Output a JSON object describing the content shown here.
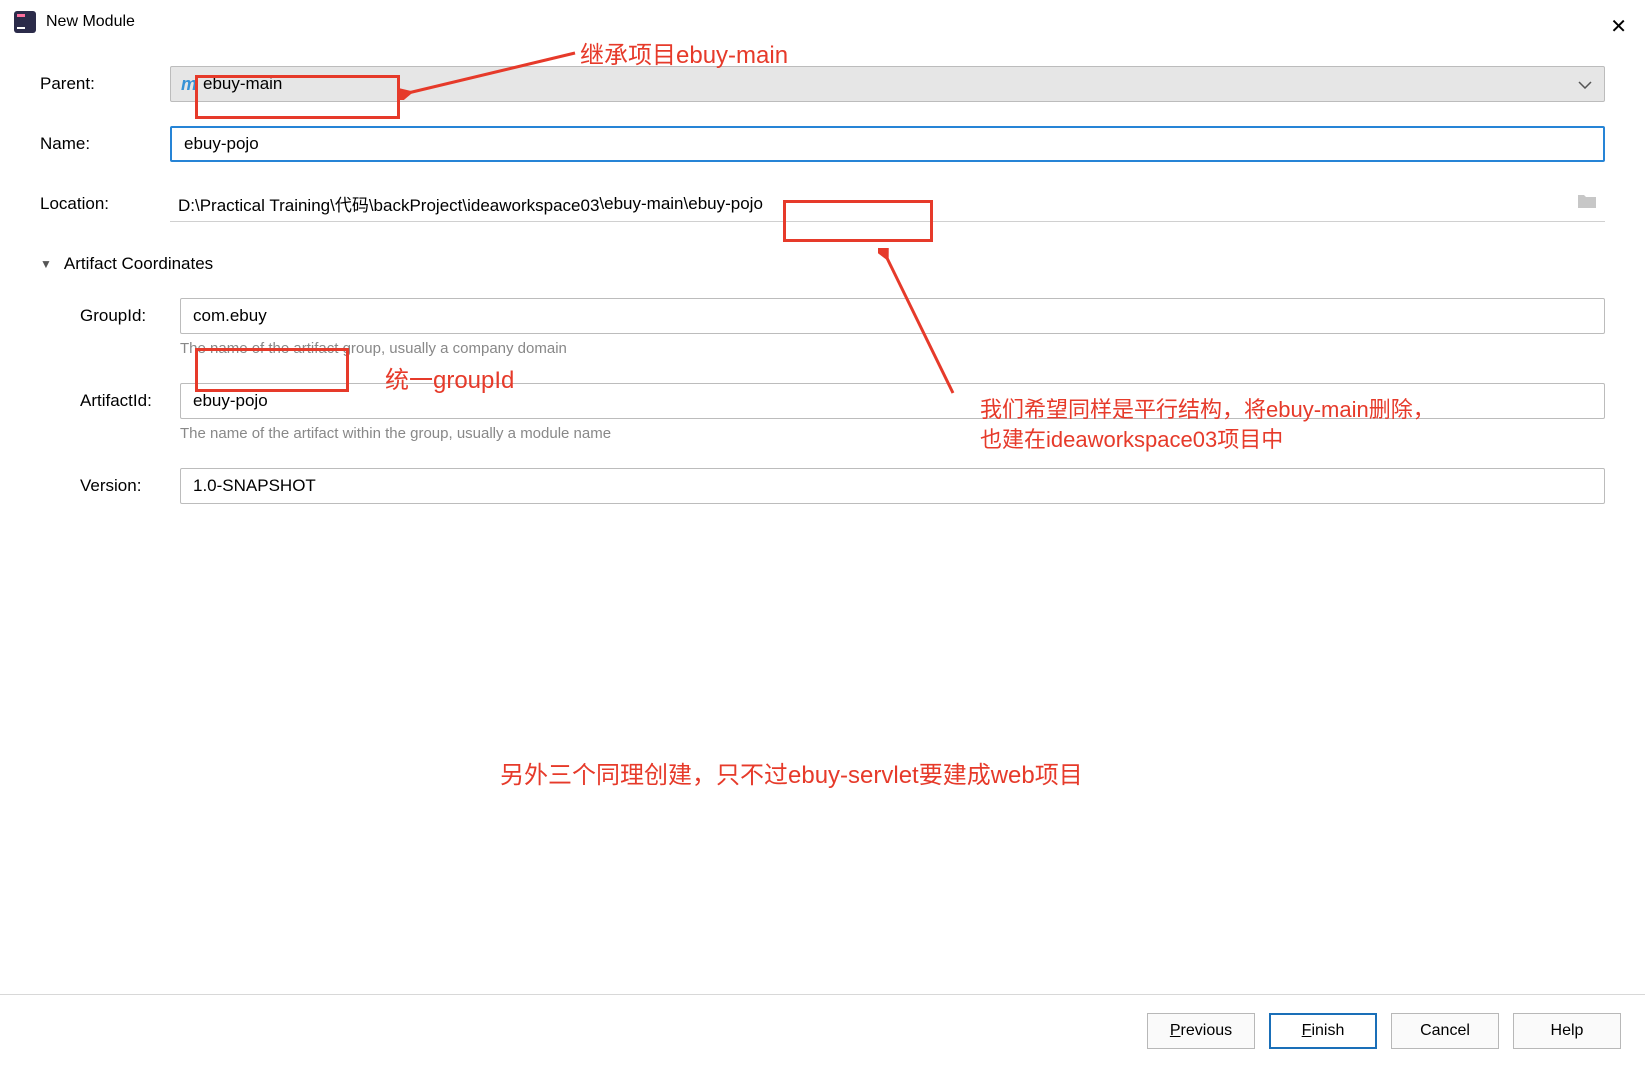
{
  "titlebar": {
    "title": "New Module"
  },
  "labels": {
    "parent": "Parent:",
    "name": "Name:",
    "location": "Location:",
    "section": "Artifact Coordinates",
    "groupId": "GroupId:",
    "artifactId": "ArtifactId:",
    "version": "Version:"
  },
  "values": {
    "parent": "ebuy-main",
    "name": "ebuy-pojo",
    "location_pre": "D:\\Practical Training\\代码\\backProject\\ideaworkspace03",
    "location_mid": "\\ebuy-main\\",
    "location_post": "ebuy-pojo",
    "groupId": "com.ebuy",
    "artifactId": "ebuy-pojo",
    "version": "1.0-SNAPSHOT"
  },
  "hints": {
    "group": "The name of the artifact group, usually a company domain",
    "artifact": "The name of the artifact within the group, usually a module name"
  },
  "buttons": {
    "previous": "revious",
    "previous_u": "P",
    "finish": "inish",
    "finish_u": "F",
    "cancel": "Cancel",
    "help": "Help"
  },
  "annotations": {
    "a1": "继承项目ebuy-main",
    "a2": "统一groupId",
    "a3_l1": "我们希望同样是平行结构，将ebuy-main删除，",
    "a3_l2": "也建在ideaworkspace03项目中",
    "a4": "另外三个同理创建，只不过ebuy-servlet要建成web项目"
  }
}
